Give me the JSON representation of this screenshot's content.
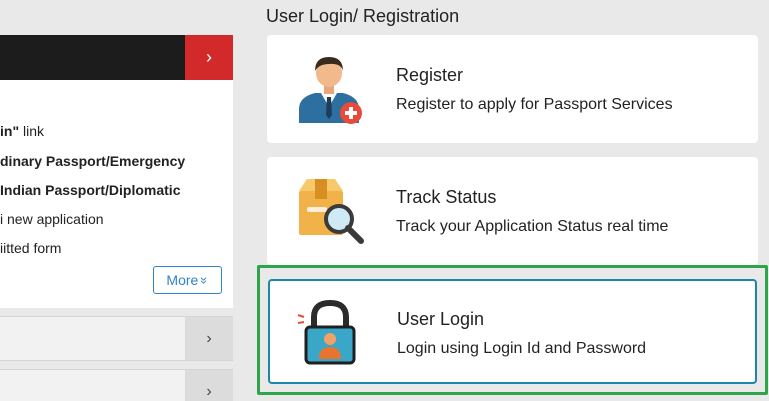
{
  "left": {
    "text_lines": [
      {
        "pre": "",
        "bold": "in\"",
        "post": " link"
      },
      {
        "pre": "",
        "bold": "dinary  Passport/Emergency",
        "post": ""
      },
      {
        "pre": "",
        "bold": "Indian  Passport/Diplomatic",
        "post": ""
      },
      {
        "pre": "i new application",
        "bold": "",
        "post": ""
      },
      {
        "pre": "iitted form",
        "bold": "",
        "post": ""
      }
    ],
    "more_label": "More",
    "more_icon": "»",
    "dark_bar_arrow": "›",
    "acc_chevron": "›"
  },
  "right": {
    "section_title": "User Login/ Registration",
    "cards": [
      {
        "title": "Register",
        "desc": "Register to apply for Passport Services"
      },
      {
        "title": "Track Status",
        "desc": "Track your Application Status real time"
      },
      {
        "title": "User Login",
        "desc": "Login using Login Id and Password"
      }
    ]
  },
  "colors": {
    "accent_red": "#d22a2a",
    "link_blue": "#2f83c5",
    "highlight_teal": "#1e87a8",
    "highlight_green": "#2ea54a"
  }
}
